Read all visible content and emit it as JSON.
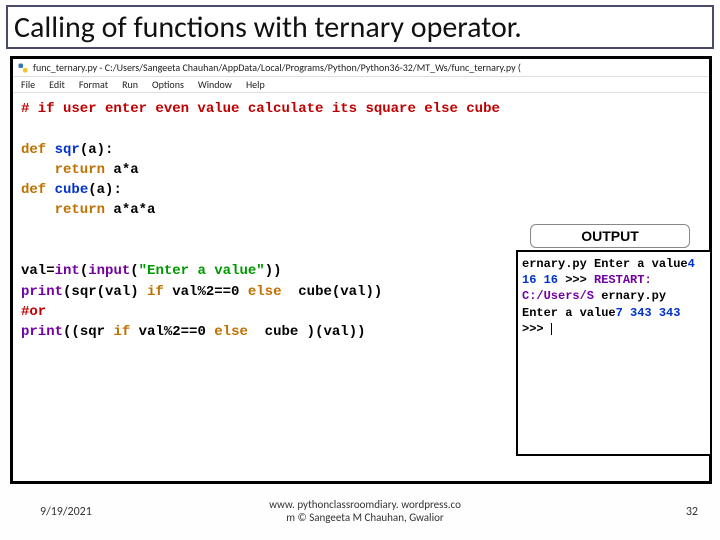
{
  "title": "Calling of functions with ternary operator.",
  "editor": {
    "file_title": "func_ternary.py - C:/Users/Sangeeta Chauhan/AppData/Local/Programs/Python/Python36-32/MT_Ws/func_ternary.py (",
    "menu": {
      "file": "File",
      "edit": "Edit",
      "format": "Format",
      "run": "Run",
      "options": "Options",
      "window": "Window",
      "help": "Help"
    }
  },
  "code": {
    "c1": "# if user enter even value calculate its square else cube",
    "kw_def1": "def",
    "fn_sqr": " sqr",
    "sqr_sig": "(a):",
    "kw_ret1": "    return",
    "sqr_body": " a*a",
    "kw_def2": "def",
    "fn_cube": " cube",
    "cube_sig": "(a):",
    "kw_ret2": "    return",
    "cube_body": " a*a*a",
    "val_lhs": "val=",
    "int": "int",
    "open1": "(",
    "input": "input",
    "open2": "(",
    "prompt": "\"Enter a value\"",
    "close12": "))",
    "print1": "print",
    "p1_a": "(sqr(val) ",
    "if1": "if",
    "p1_b": " val%2==0 ",
    "else1": "else",
    "p1_c": "  cube(val))",
    "c2": "#or",
    "print2": "print",
    "p2_a": "((sqr ",
    "if2": "if",
    "p2_b": " val%2==0 ",
    "else2": "else",
    "p2_c": "  cube )(val))"
  },
  "output": {
    "label": "OUTPUT",
    "l1": "ernary.py",
    "l2a": "Enter a value",
    "l2b": "4",
    "l3": "16",
    "l4": "16",
    "l5": ">>>",
    "l6": " RESTART: C:/Users/S",
    "l7": "ernary.py",
    "l8a": "Enter a value",
    "l8b": "7",
    "l9": "343",
    "l10": "343",
    "l11": ">>> "
  },
  "footer": {
    "date": "9/19/2021",
    "center1": "www. pythonclassroomdiary. wordpress.co",
    "center2": "m  © Sangeeta M Chauhan, Gwalior",
    "page": "32"
  }
}
